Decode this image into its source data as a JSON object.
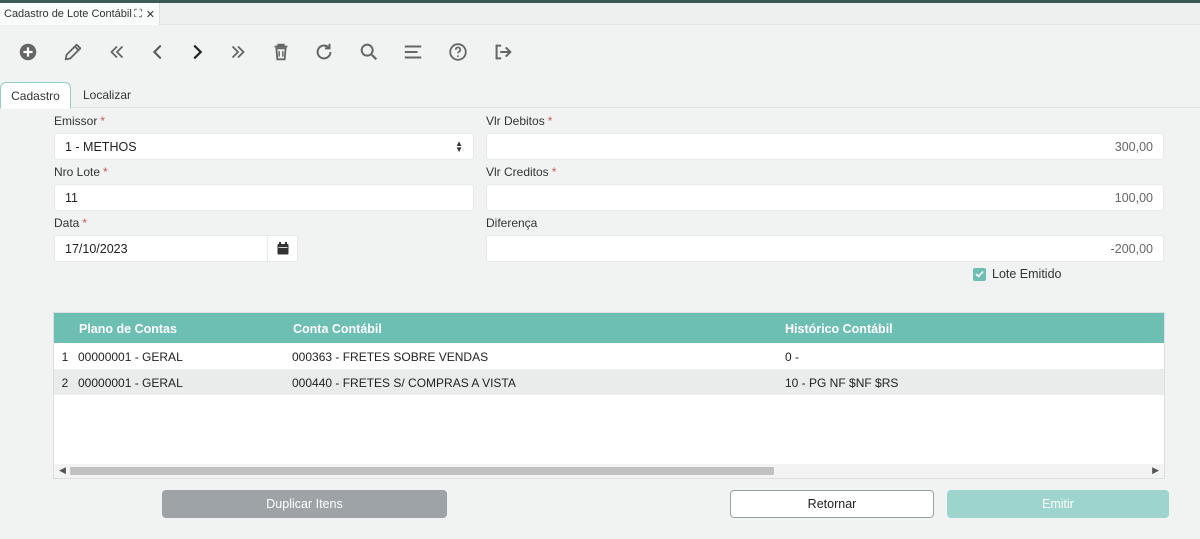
{
  "window": {
    "tab_title": "Cadastro de Lote Contábil",
    "maximize_icon": "expand-icon",
    "close_icon": "close-icon"
  },
  "toolbar": {
    "icons": [
      "add-circle-icon",
      "pencil-icon",
      "first-record-icon",
      "previous-record-icon",
      "next-record-icon",
      "last-record-icon",
      "trash-icon",
      "refresh-icon",
      "search-icon",
      "menu-lines-icon",
      "help-circle-icon",
      "exit-icon"
    ]
  },
  "tabs": [
    {
      "label": "Cadastro",
      "active": true
    },
    {
      "label": "Localizar",
      "active": false
    }
  ],
  "form": {
    "emissor": {
      "label": "Emissor",
      "required_mark": "*",
      "value": "1 - METHOS"
    },
    "nro_lote": {
      "label": "Nro Lote",
      "required_mark": "*",
      "value": "11"
    },
    "data": {
      "label": "Data",
      "required_mark": "*",
      "value": "17/10/2023"
    },
    "vlr_debitos": {
      "label": "Vlr Debitos",
      "required_mark": "*",
      "value": "300,00"
    },
    "vlr_creditos": {
      "label": "Vlr Creditos",
      "required_mark": "*",
      "value": "100,00"
    },
    "diferenca": {
      "label": "Diferença",
      "value": "-200,00"
    },
    "lote_emitido": {
      "label": "Lote Emitido",
      "checked": true
    }
  },
  "grid": {
    "columns": [
      "Plano de Contas",
      "Conta Contábil",
      "Histórico Contábil"
    ],
    "rows": [
      {
        "num": "1",
        "plano": "00000001 - GERAL",
        "conta": "000363 - FRETES SOBRE VENDAS",
        "historico": "0 -"
      },
      {
        "num": "2",
        "plano": "00000001 - GERAL",
        "conta": "000440 - FRETES S/ COMPRAS A VISTA",
        "historico": "10 - PG NF $NF $RS"
      }
    ]
  },
  "buttons": {
    "duplicar": "Duplicar Itens",
    "retornar": "Retornar",
    "emitir": "Emitir"
  },
  "colors": {
    "accent": "#6dbeb3",
    "required": "#d9534f",
    "disabled_button": "#9da3a6"
  }
}
